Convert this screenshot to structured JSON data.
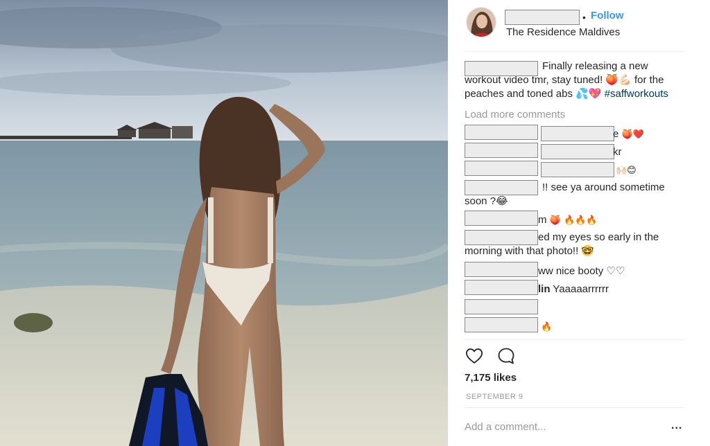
{
  "post": {
    "location": "The Residence Maldives",
    "follow_label": "Follow",
    "separator": "•",
    "caption": {
      "text": "Finally releasing a new workout video tmr, stay tuned! 🍑💪🏻 for the peaches and toned abs 💦💖 ",
      "hashtag": "#saffworkouts"
    },
    "load_more": "Load more comments",
    "comments": [
      {
        "tail": "e",
        "emoji": "🍑❤️"
      },
      {
        "tail": "kr"
      },
      {
        "emoji": "🙌🏻😊"
      },
      {
        "text": "!! see ya around sometime soon ?😂"
      },
      {
        "tail": "m",
        "emoji": "🍑 🔥🔥🔥"
      },
      {
        "text": "ed my eyes so early in the morning with that photo!! 🤓"
      },
      {
        "tail": "ww nice booty ♡♡"
      },
      {
        "tail": "lin",
        "text": " Yaaaaarrrrrr"
      },
      {
        "emoji": "🔥"
      }
    ],
    "likes": "7,175 likes",
    "date": "SEPTEMBER 9",
    "add_comment_placeholder": "Add a comment...",
    "more_label": "..."
  },
  "icons": {
    "like": "heart-icon",
    "comment": "speech-bubble-icon",
    "more": "ellipsis-icon"
  },
  "colors": {
    "follow": "#3897f0",
    "hashtag": "#003569",
    "muted": "#999999",
    "text": "#262626"
  }
}
